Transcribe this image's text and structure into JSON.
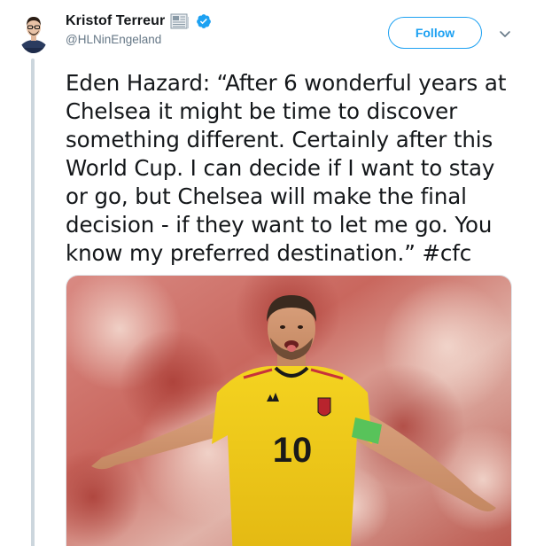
{
  "author": {
    "display_name": "Kristof Terreur",
    "handle": "@HLNinEngeland",
    "badge_icon": "newspaper-icon",
    "verified_icon": "verified-badge-icon",
    "avatar_caption": "KRISTOF TERREUR"
  },
  "actions": {
    "follow_label": "Follow",
    "menu_icon": "chevron-down-icon"
  },
  "tweet": {
    "text": "Eden Hazard: “After 6 wonderful years at Chelsea it might be time to discover something different. Certainly after this World Cup. I can decide if I want to stay or go, but Chelsea will make the final decision - if they want to let me go. You know my preferred destination.” ",
    "hashtag": "#cfc"
  },
  "media": {
    "shirt_number": "10",
    "description_icon": "photo-player-celebrating"
  },
  "colors": {
    "accent": "#1da1f2",
    "text": "#14171a",
    "secondary": "#657786",
    "thread": "#ccd6dd",
    "jersey": "#f2cc1b"
  }
}
